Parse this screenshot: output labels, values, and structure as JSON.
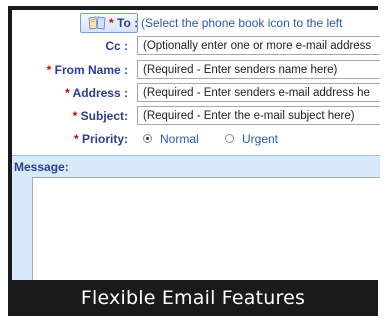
{
  "form": {
    "to": {
      "label": "To :",
      "required_mark": "*",
      "hint": "(Select the phone book icon to the left"
    },
    "cc": {
      "label": "Cc :",
      "value": "(Optionally enter one or more e-mail address"
    },
    "from_name": {
      "label": "From Name :",
      "required_mark": "*",
      "value": "(Required - Enter senders name here)"
    },
    "address": {
      "label": "Address :",
      "required_mark": "*",
      "value": "(Required - Enter senders e-mail address he"
    },
    "subject": {
      "label": "Subject:",
      "required_mark": "*",
      "value": "(Required - Enter the e-mail subject here)"
    },
    "priority": {
      "label": "Priority:",
      "required_mark": "*",
      "options": [
        {
          "label": "Normal",
          "selected": true
        },
        {
          "label": "Urgent",
          "selected": false
        }
      ]
    }
  },
  "message": {
    "label": "Message:",
    "value": ""
  },
  "caption": "Flexible Email Features",
  "icons": {
    "to_button": "phone-book-icon"
  },
  "colors": {
    "label": "#2c3e8c",
    "required": "#cc0000",
    "hint": "#2b58b8",
    "message_bar": "#d7e9fa",
    "frame": "#1a1a1a"
  }
}
